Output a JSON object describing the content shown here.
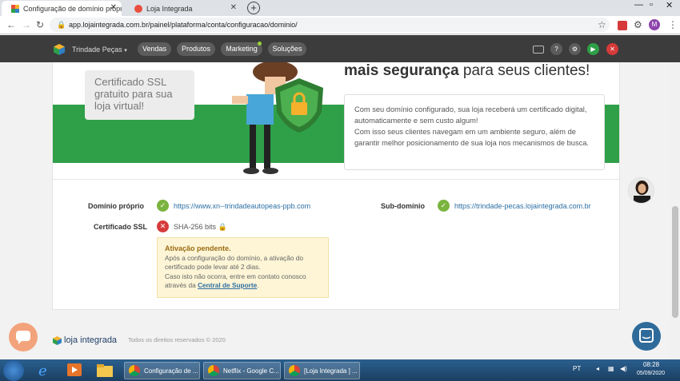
{
  "browser": {
    "tabs": [
      {
        "title": "Configuração de domínio próprio",
        "active": true
      },
      {
        "title": "Loja Integrada",
        "active": false
      }
    ],
    "url": "app.lojaintegrada.com.br/painel/plataforma/conta/configuracao/dominio/",
    "profile_initial": "M"
  },
  "appbar": {
    "store_name": "Trindade Peças",
    "menu": [
      "Vendas",
      "Produtos",
      "Marketing",
      "Soluções"
    ]
  },
  "hero": {
    "ssl_promo": "Certificado SSL gratuito para sua loja virtual!",
    "headline_bold": "mais segurança",
    "headline_rest": " para seus clientes!",
    "info_p1": "Com seu domínio configurado, sua loja receberá um certificado digital, automaticamente e sem custo algum!",
    "info_p2": "Com isso seus clientes navegam em um ambiente seguro, além de garantir melhor posicionamento de sua loja nos mecanismos de busca."
  },
  "domain": {
    "own_label": "Domínio próprio",
    "own_url": "https://www.xn--trindadeautopeas-ppb.com",
    "sub_label": "Sub-domínio",
    "sub_url": "https://trindade-pecas.lojaintegrada.com.br",
    "ssl_label": "Certificado SSL",
    "ssl_value": "SHA-256 bits"
  },
  "warning": {
    "title": "Ativação pendente.",
    "text1": "Após a configuração do domínio, a ativação do certificado pode levar até 2 dias.",
    "text2": "Caso isto não ocorra, entre em contato conosco através da ",
    "link": "Central de Suporte",
    "end": "."
  },
  "footer": {
    "brand": "loja integrada",
    "copyright": "Todos os direitos reservados © 2020"
  },
  "taskbar": {
    "windows": [
      "Configuração de ...",
      "Netflix - Google C...",
      "[Loja Integrada ] ..."
    ],
    "lang": "PT",
    "time": "08:28",
    "date": "05/09/2020"
  },
  "colors": {
    "accent_green": "#2fa048",
    "appbar": "#3c3c3c",
    "link": "#2d6fa3"
  }
}
